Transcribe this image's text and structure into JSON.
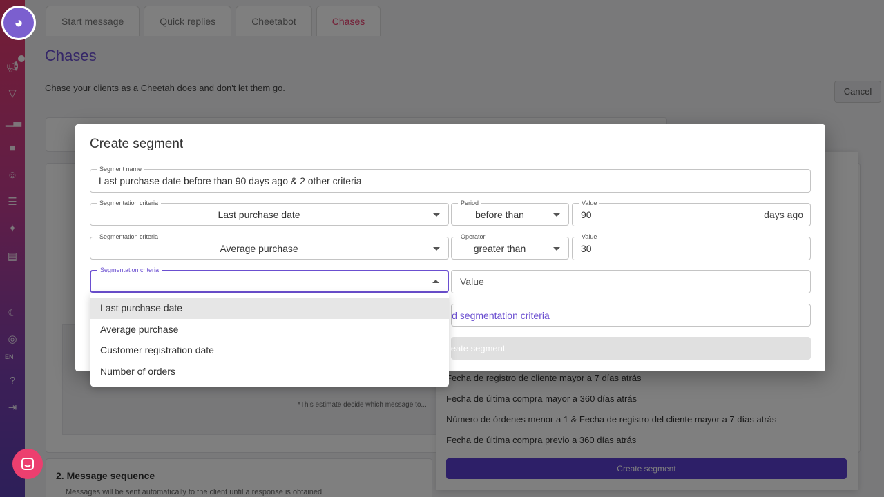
{
  "background": {
    "tabs": [
      "Start message",
      "Quick replies",
      "Cheetabot",
      "Chases"
    ],
    "active_tab": "Chases",
    "title": "Chases",
    "subtitle": "Chase your clients as a Cheetah does and don't let them go.",
    "cancel_label": "Cancel",
    "section2_title": "2. Message sequence",
    "section2_sub": "Messages will be sent automatically to the client until a response is obtained",
    "panel_items": [
      "Fecha de registro de cliente mayor a 7 días atrás",
      "Fecha de última compra mayor a 360 días atrás",
      "Número de órdenes menor a 1 & Fecha de registro del cliente mayor a 7 días atrás",
      "Fecha de última compra previo a 360 días atrás"
    ],
    "panel_button": "Create segment",
    "estimate_note": "*This estimate decide which message to..."
  },
  "sidebar": {
    "lang": "EN"
  },
  "modal": {
    "title": "Create segment",
    "segment_name": {
      "label": "Segment name",
      "value": "Last purchase date before than 90 days ago & 2 other criteria"
    },
    "rows": [
      {
        "criteria_label": "Segmentation criteria",
        "criteria_value": "Last purchase date",
        "op_label": "Period",
        "op_value": "before than",
        "value_label": "Value",
        "value": "90",
        "suffix": "days ago"
      },
      {
        "criteria_label": "Segmentation criteria",
        "criteria_value": "Average purchase",
        "op_label": "Operator",
        "op_value": "greater than",
        "value_label": "Value",
        "value": "30"
      }
    ],
    "active_row": {
      "criteria_label": "Segmentation criteria",
      "value_placeholder": "Value"
    },
    "add_criteria": "Add segmentation criteria",
    "create_button": "Create segment"
  },
  "dropdown": {
    "options": [
      "Last purchase date",
      "Average purchase",
      "Customer registration date",
      "Number of orders"
    ],
    "highlighted": "Last purchase date"
  }
}
